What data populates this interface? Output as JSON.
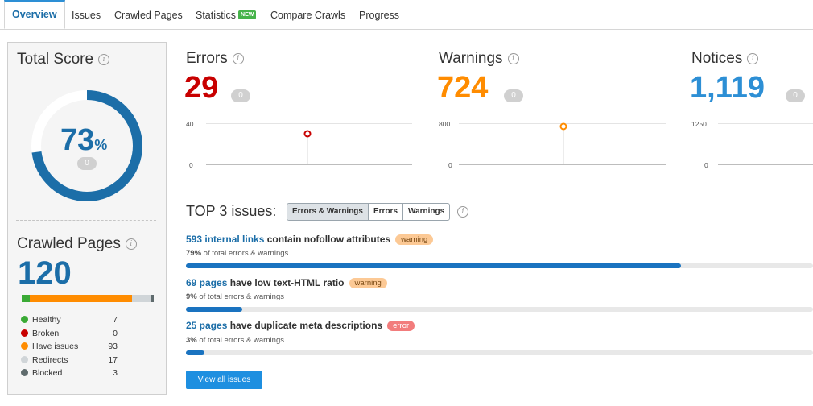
{
  "tabs": [
    {
      "label": "Overview",
      "active": true
    },
    {
      "label": "Issues"
    },
    {
      "label": "Crawled Pages"
    },
    {
      "label": "Statistics",
      "badge": "NEW"
    },
    {
      "label": "Compare Crawls"
    },
    {
      "label": "Progress"
    }
  ],
  "total_score": {
    "title": "Total Score",
    "value": "73",
    "unit": "%",
    "delta": "0",
    "fraction": 0.73
  },
  "crawled_pages": {
    "title": "Crawled Pages",
    "value": "120",
    "legend": [
      {
        "label": "Healthy",
        "value": "7",
        "color": "#3aaa35"
      },
      {
        "label": "Broken",
        "value": "0",
        "color": "#c80000"
      },
      {
        "label": "Have issues",
        "value": "93",
        "color": "#ff8c00"
      },
      {
        "label": "Redirects",
        "value": "17",
        "color": "#d0d5d8"
      },
      {
        "label": "Blocked",
        "value": "3",
        "color": "#5f6b6d"
      }
    ]
  },
  "errors": {
    "title": "Errors",
    "value": "29",
    "delta": "0",
    "color": "#c80000",
    "ytick_max": "40",
    "ytick_min": "0"
  },
  "warnings": {
    "title": "Warnings",
    "value": "724",
    "delta": "0",
    "color": "#ff8c00",
    "ytick_max": "800",
    "ytick_min": "0"
  },
  "notices": {
    "title": "Notices",
    "value": "1,119",
    "delta": "0",
    "color": "#2d8fd5",
    "ytick_max": "1250",
    "ytick_min": "0"
  },
  "top_issues": {
    "title": "TOP 3 issues:",
    "filters": [
      "Errors & Warnings",
      "Errors",
      "Warnings"
    ],
    "items": [
      {
        "link": "593 internal links",
        "text": " contain nofollow attributes",
        "tag": "warning",
        "pct": "79%",
        "sub": " of total errors & warnings",
        "fraction": 0.79
      },
      {
        "link": "69 pages",
        "text": " have low text-HTML ratio",
        "tag": "warning",
        "pct": "9%",
        "sub": " of total errors & warnings",
        "fraction": 0.09
      },
      {
        "link": "25 pages",
        "text": " have duplicate meta descriptions",
        "tag": "error",
        "pct": "3%",
        "sub": " of total errors & warnings",
        "fraction": 0.03
      }
    ],
    "view_all": "View all issues"
  }
}
